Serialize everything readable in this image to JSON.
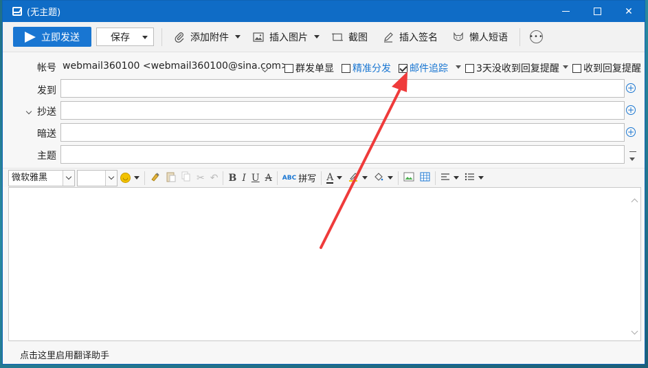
{
  "window": {
    "title": "(无主题)"
  },
  "toolbar": {
    "send_label": "立即发送",
    "save_label": "保存",
    "attach_label": "添加附件",
    "insert_image_label": "插入图片",
    "screenshot_label": "截图",
    "signature_label": "插入签名",
    "lazy_reply_label": "懒人短语"
  },
  "header": {
    "account_label": "帐号",
    "account_value": "webmail360100 <webmail360100@sina.com>",
    "options": {
      "group_single": "群发单显",
      "precise_send": "精准分发",
      "tracking": "邮件追踪",
      "no_reply_3days": "3天没收到回复提醒",
      "reply_received": "收到回复提醒"
    },
    "to_label": "发到",
    "cc_label": "抄送",
    "bcc_label": "暗送",
    "subject_label": "主题"
  },
  "format": {
    "font_value": "微软雅黑",
    "spellcheck_label": "拼写",
    "bold": "B",
    "italic": "I",
    "underline": "U",
    "strike": "A"
  },
  "status": {
    "translator_link": "点击这里启用翻译助手"
  },
  "colors": {
    "accent": "#1976d2",
    "titlebar": "#0f6cc6",
    "annotation_arrow": "#ef3b3b"
  }
}
